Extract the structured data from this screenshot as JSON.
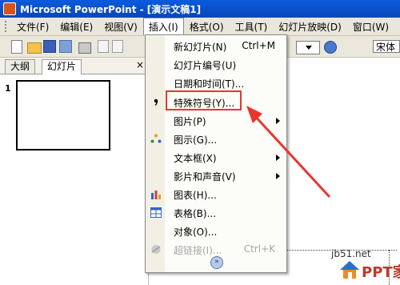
{
  "window": {
    "title": "Microsoft PowerPoint - [演示文稿1]"
  },
  "menubar": {
    "items": [
      "文件(F)",
      "编辑(E)",
      "视图(V)",
      "插入(I)",
      "格式(O)",
      "工具(T)",
      "幻灯片放映(D)",
      "窗口(W)",
      "帮"
    ]
  },
  "toolbar": {
    "font_name": "宋体"
  },
  "left_pane": {
    "tabs": [
      "大纲",
      "幻灯片"
    ],
    "close": "×",
    "slide_number": "1"
  },
  "insert_menu": {
    "items": [
      {
        "label": "新幻灯片(N)",
        "shortcut": "Ctrl+M",
        "icon": "new-slide-icon"
      },
      {
        "label": "幻灯片编号(U)",
        "shortcut": "",
        "icon": ""
      },
      {
        "label": "日期和时间(T)...",
        "shortcut": "",
        "icon": ""
      },
      {
        "label": "特殊符号(Y)...",
        "shortcut": "",
        "icon": "comma-symbol-icon"
      },
      {
        "label": "图片(P)",
        "shortcut": "",
        "icon": "",
        "submenu": true
      },
      {
        "label": "图示(G)...",
        "shortcut": "",
        "icon": "diagram-icon"
      },
      {
        "label": "文本框(X)",
        "shortcut": "",
        "icon": "",
        "submenu": true
      },
      {
        "label": "影片和声音(V)",
        "shortcut": "",
        "icon": "",
        "submenu": true
      },
      {
        "label": "图表(H)...",
        "shortcut": "",
        "icon": "chart-icon"
      },
      {
        "label": "表格(B)...",
        "shortcut": "",
        "icon": "table-icon"
      },
      {
        "label": "对象(O)...",
        "shortcut": "",
        "icon": ""
      },
      {
        "label": "超链接(I)...",
        "shortcut": "Ctrl+K",
        "icon": "hyperlink-icon",
        "disabled": true
      }
    ],
    "expand": "»"
  },
  "watermark": {
    "url": "jb51.net",
    "brand": "PPT家园"
  },
  "colors": {
    "highlight": "#e8362f",
    "titlebar": "#0a5bdc"
  }
}
